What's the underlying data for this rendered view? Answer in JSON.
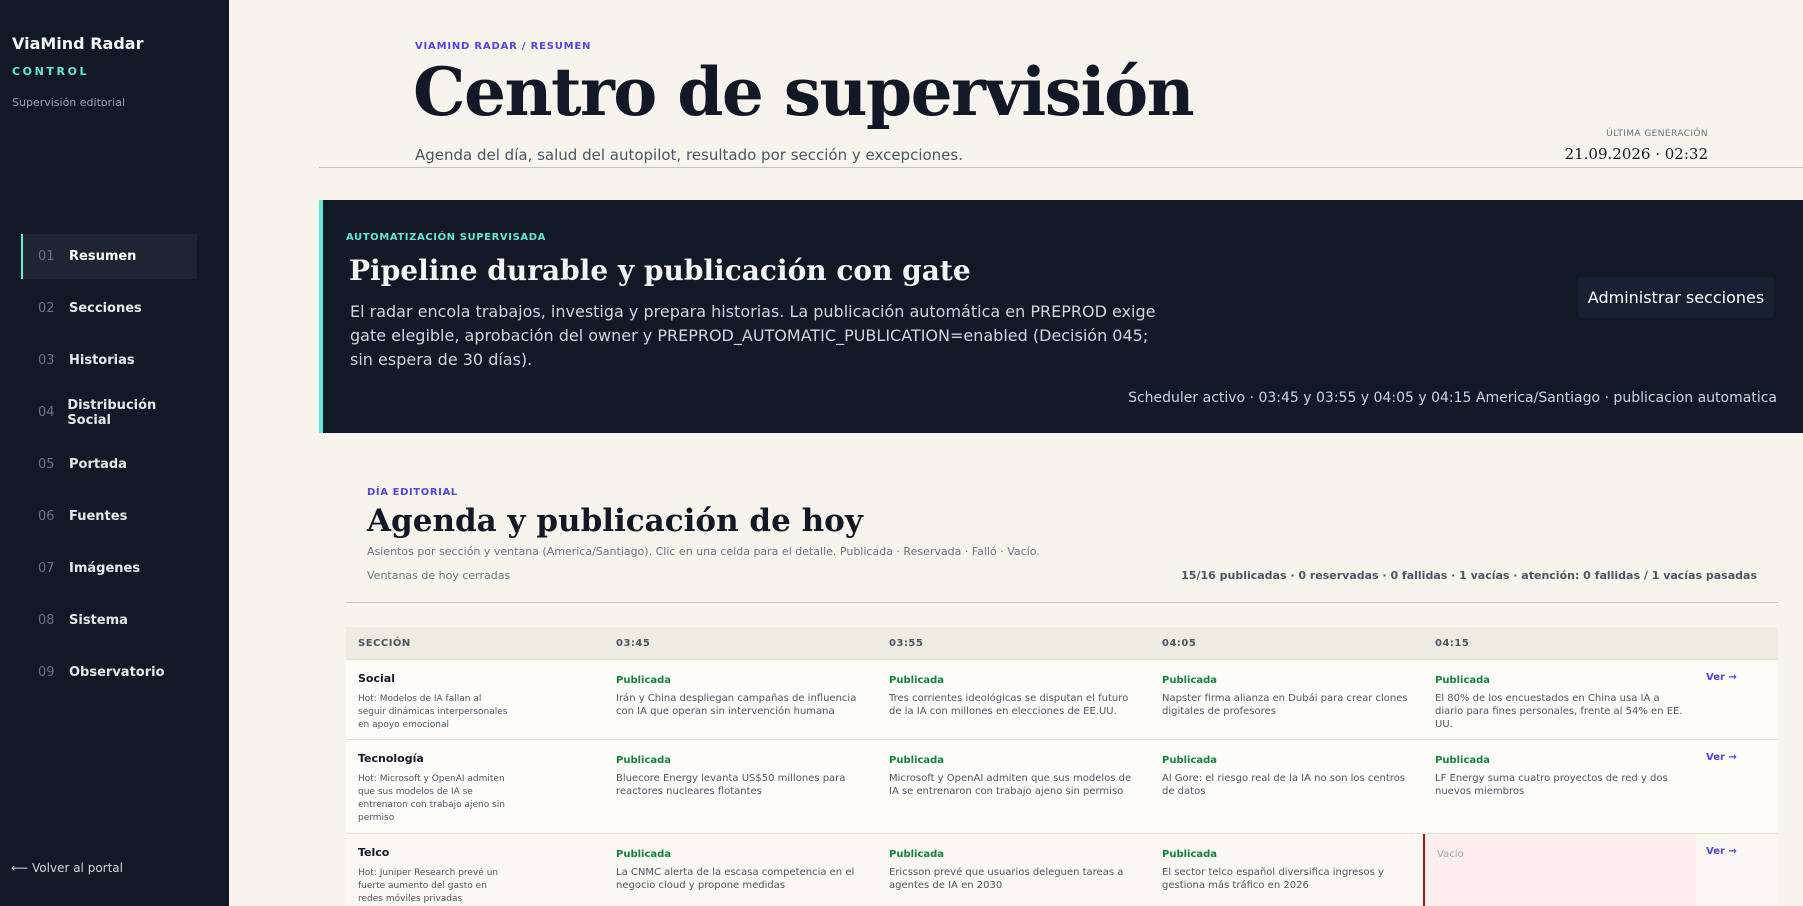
{
  "sidebar": {
    "brand": "ViaMind Radar",
    "brand_sub": "CONTROL",
    "brand_desc": "Supervisión editorial",
    "items": [
      {
        "num": "01",
        "label": "Resumen"
      },
      {
        "num": "02",
        "label": "Secciones"
      },
      {
        "num": "03",
        "label": "Historias"
      },
      {
        "num": "04",
        "label": "Distribución Social"
      },
      {
        "num": "05",
        "label": "Portada"
      },
      {
        "num": "06",
        "label": "Fuentes"
      },
      {
        "num": "07",
        "label": "Imágenes"
      },
      {
        "num": "08",
        "label": "Sistema"
      },
      {
        "num": "09",
        "label": "Observatorio"
      }
    ],
    "back": "⟵ Volver al portal"
  },
  "header": {
    "breadcrumb": "VIAMIND RADAR / RESUMEN",
    "title": "Centro de supervisión",
    "subtitle": "Agenda del día, salud del autopilot, resultado por sección y excepciones.",
    "gen_label": "ÚLTIMA GENERACIÓN",
    "gen_value": "21.09.2026 · 02:32"
  },
  "banner": {
    "kicker": "AUTOMATIZACIÓN SUPERVISADA",
    "title": "Pipeline durable y publicación con gate",
    "text": "El radar encola trabajos, investiga y prepara historias. La publicación automática en PREPROD exige gate elegible, aprobación del owner y PREPROD_AUTOMATIC_PUBLICATION=enabled (Decisión 045; sin espera de 30 días).",
    "button": "Administrar secciones",
    "schedule": "Scheduler activo · 03:45 y 03:55 y 04:05 y 04:15 America/Santiago · publicacion automatica"
  },
  "agenda": {
    "kicker": "DÍA EDITORIAL",
    "title": "Agenda y publicación de hoy",
    "desc": "Asientos por sección y ventana (America/Santiago). Clic en una celda para el detalle. Publicada · Reservada · Falló · Vacío.",
    "closed": "Ventanas de hoy cerradas",
    "stats": "15/16 publicadas · 0 reservadas · 0 fallidas · 1 vacías · atención: 0 fallidas / 1 vacías pasadas"
  },
  "table": {
    "headers": [
      "SECCIÓN",
      "03:45",
      "03:55",
      "04:05",
      "04:15"
    ],
    "ver_label": "Ver →",
    "rows": [
      {
        "name": "Social",
        "hot": "Hot: Modelos de IA fallan al seguir dinámicas interpersonales en apoyo emocional",
        "cells": [
          {
            "status": "Publicada",
            "story": "Irán y China despliegan campañas de influencia con IA que operan sin intervención humana"
          },
          {
            "status": "Publicada",
            "story": "Tres corrientes ideológicas se disputan el futuro de la IA con millones en elecciones de EE.UU."
          },
          {
            "status": "Publicada",
            "story": "Napster firma alianza en Dubái para crear clones digitales de profesores"
          },
          {
            "status": "Publicada",
            "story": "El 80% de los encuestados en China usa IA a diario para fines personales, frente al 54% en EE. UU."
          }
        ]
      },
      {
        "name": "Tecnología",
        "hot": "Hot: Microsoft y OpenAI admiten que sus modelos de IA se entrenaron con trabajo ajeno sin permiso",
        "cells": [
          {
            "status": "Publicada",
            "story": "Bluecore Energy levanta US$50 millones para reactores nucleares flotantes"
          },
          {
            "status": "Publicada",
            "story": "Microsoft y OpenAI admiten que sus modelos de IA se entrenaron con trabajo ajeno sin permiso"
          },
          {
            "status": "Publicada",
            "story": "Al Gore: el riesgo real de la IA no son los centros de datos"
          },
          {
            "status": "Publicada",
            "story": "LF Energy suma cuatro proyectos de red y dos nuevos miembros"
          }
        ]
      },
      {
        "name": "Telco",
        "hot": "Hot: Juniper Research prevé un fuerte aumento del gasto en redes móviles privadas",
        "cells": [
          {
            "status": "Publicada",
            "story": "La CNMC alerta de la escasa competencia en el negocio cloud y propone medidas"
          },
          {
            "status": "Publicada",
            "story": "Ericsson prevé que usuarios deleguen tareas a agentes de IA en 2030"
          },
          {
            "status": "Publicada",
            "story": "El sector telco español diversifica ingresos y gestiona más tráfico en 2026"
          },
          {
            "status": "Vacío",
            "story": ""
          }
        ]
      }
    ]
  }
}
